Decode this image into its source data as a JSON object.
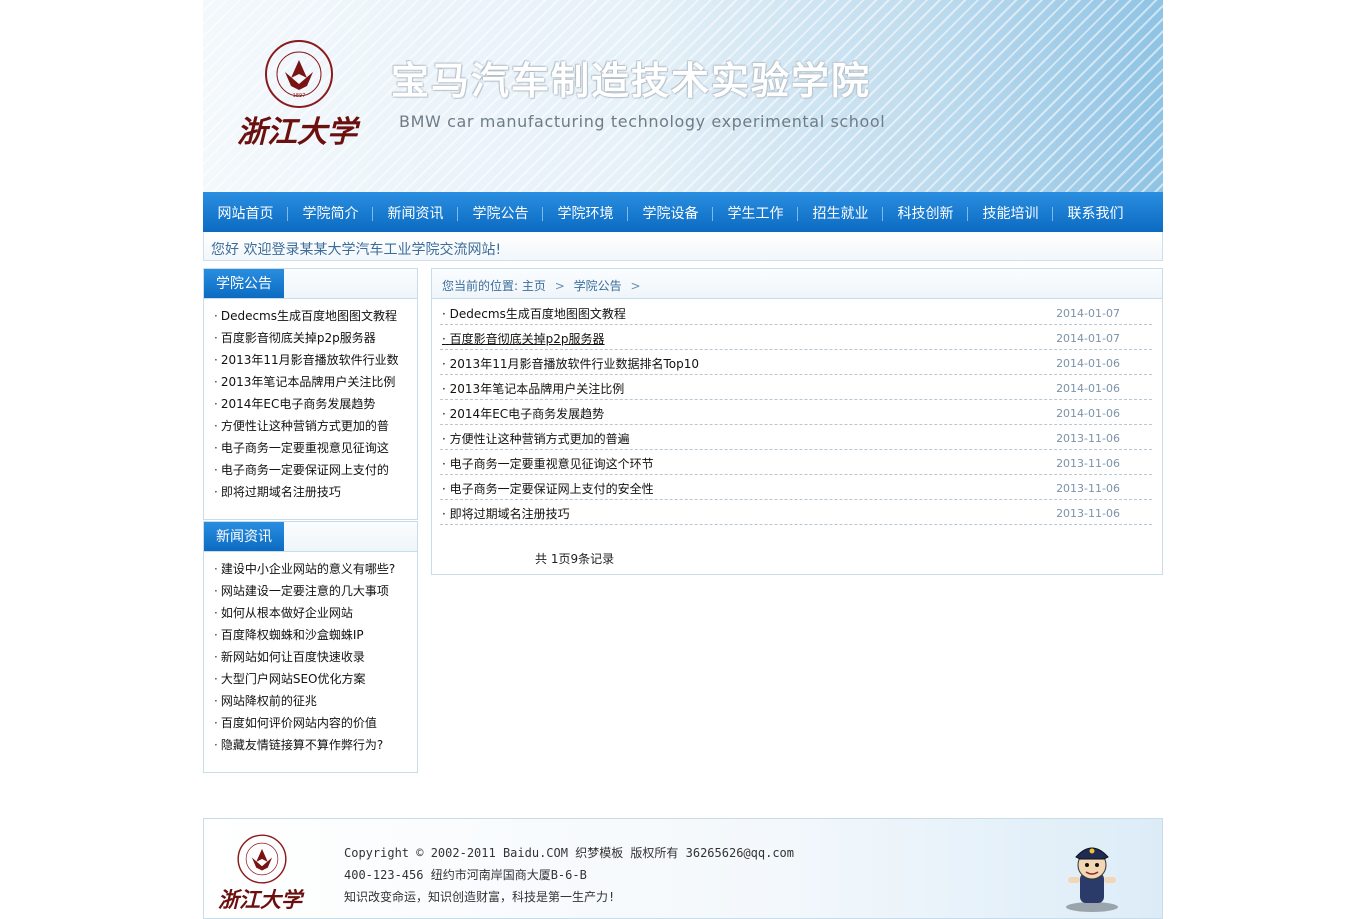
{
  "header": {
    "title_cn": "宝马汽车制造技术实验学院",
    "title_en": "BMW car manufacturing technology experimental school",
    "logo_text": "浙江大学",
    "emblem_text": "ZHEJIANG UNIVERSITY 1897"
  },
  "nav": {
    "items": [
      "网站首页",
      "学院简介",
      "新闻资讯",
      "学院公告",
      "学院环境",
      "学院设备",
      "学生工作",
      "招生就业",
      "科技创新",
      "技能培训",
      "联系我们"
    ]
  },
  "welcome": "您好  欢迎登录某某大学汽车工业学院交流网站!",
  "sidebar": {
    "announcements": {
      "title": "学院公告",
      "items": [
        "Dedecms生成百度地图图文教程",
        "百度影音彻底关掉p2p服务器",
        "2013年11月影音播放软件行业数",
        "2013年笔记本品牌用户关注比例",
        "2014年EC电子商务发展趋势",
        "方便性让这种营销方式更加的普",
        "电子商务一定要重视意见征询这",
        "电子商务一定要保证网上支付的",
        "即将过期域名注册技巧"
      ]
    },
    "news": {
      "title": "新闻资讯",
      "items": [
        "建设中小企业网站的意义有哪些?",
        "网站建设一定要注意的几大事项",
        "如何从根本做好企业网站",
        "百度降权蜘蛛和沙盒蜘蛛IP",
        "新网站如何让百度快速收录",
        "大型门户网站SEO优化方案",
        "网站降权前的征兆",
        "百度如何评价网站内容的价值",
        "隐藏友情链接算不算作弊行为?"
      ]
    }
  },
  "breadcrumb": {
    "prefix": "您当前的位置:",
    "home": "主页",
    "current": "学院公告",
    "separator": ">"
  },
  "articles": [
    {
      "title": "Dedecms生成百度地图图文教程",
      "date": "2014-01-07"
    },
    {
      "title": "百度影音彻底关掉p2p服务器",
      "date": "2014-01-07"
    },
    {
      "title": "2013年11月影音播放软件行业数据排名Top10",
      "date": "2014-01-06"
    },
    {
      "title": "2013年笔记本品牌用户关注比例",
      "date": "2014-01-06"
    },
    {
      "title": "2014年EC电子商务发展趋势",
      "date": "2014-01-06"
    },
    {
      "title": "方便性让这种营销方式更加的普遍",
      "date": "2013-11-06"
    },
    {
      "title": "电子商务一定要重视意见征询这个环节",
      "date": "2013-11-06"
    },
    {
      "title": "电子商务一定要保证网上支付的安全性",
      "date": "2013-11-06"
    },
    {
      "title": "即将过期域名注册技巧",
      "date": "2013-11-06"
    }
  ],
  "bullet": "·",
  "pager": "共 1页9条记录",
  "footer": {
    "copyright": "Copyright © 2002-2011 Baidu.COM 织梦模板 版权所有 36265626@qq.com",
    "contact": "400-123-456 纽约市河南岸国商大厦B-6-B",
    "slogan": "知识改变命运，知识创造财富，科技是第一生产力!"
  },
  "colors": {
    "nav_blue": "#0b6bc2",
    "link_blue": "#3c6d9a",
    "date_gray": "#7b93a9",
    "border": "#c8dcea"
  }
}
